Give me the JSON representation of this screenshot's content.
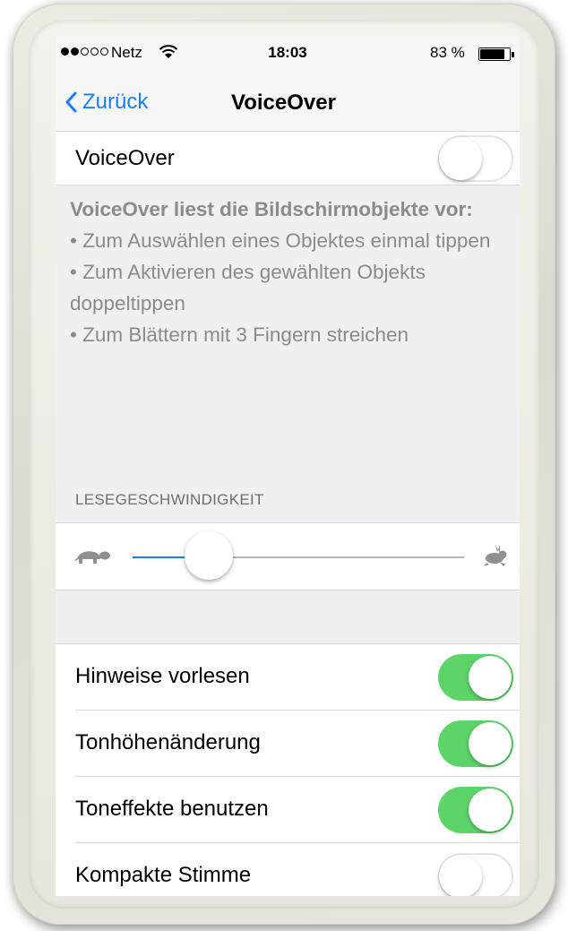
{
  "status_bar": {
    "carrier": "Netz",
    "time": "18:03",
    "battery_percent": "83 %",
    "battery_level": 0.83,
    "signal_filled": 2,
    "signal_total": 5
  },
  "nav": {
    "back_label": "Zurück",
    "title": "VoiceOver"
  },
  "voiceover_row": {
    "label": "VoiceOver",
    "enabled": false
  },
  "description": {
    "heading": "VoiceOver liest die Bildschirmobjekte vor:",
    "line1": "• Zum Auswählen eines Objektes einmal tippen",
    "line2": "• Zum Aktivieren des gewählten Objekts doppeltippen",
    "line3": "• Zum Blättern mit 3 Fingern streichen"
  },
  "speaking_rate": {
    "header": "LESEGESCHWINDIGKEIT",
    "value_fraction": 0.23
  },
  "settings": [
    {
      "label": "Hinweise vorlesen",
      "enabled": true
    },
    {
      "label": "Tonhöhenänderung",
      "enabled": true
    },
    {
      "label": "Toneffekte benutzen",
      "enabled": true
    },
    {
      "label": "Kompakte Stimme",
      "enabled": false
    }
  ],
  "colors": {
    "accent": "#1a7ff7",
    "switch_on": "#5cd468",
    "background": "#efeff4"
  }
}
